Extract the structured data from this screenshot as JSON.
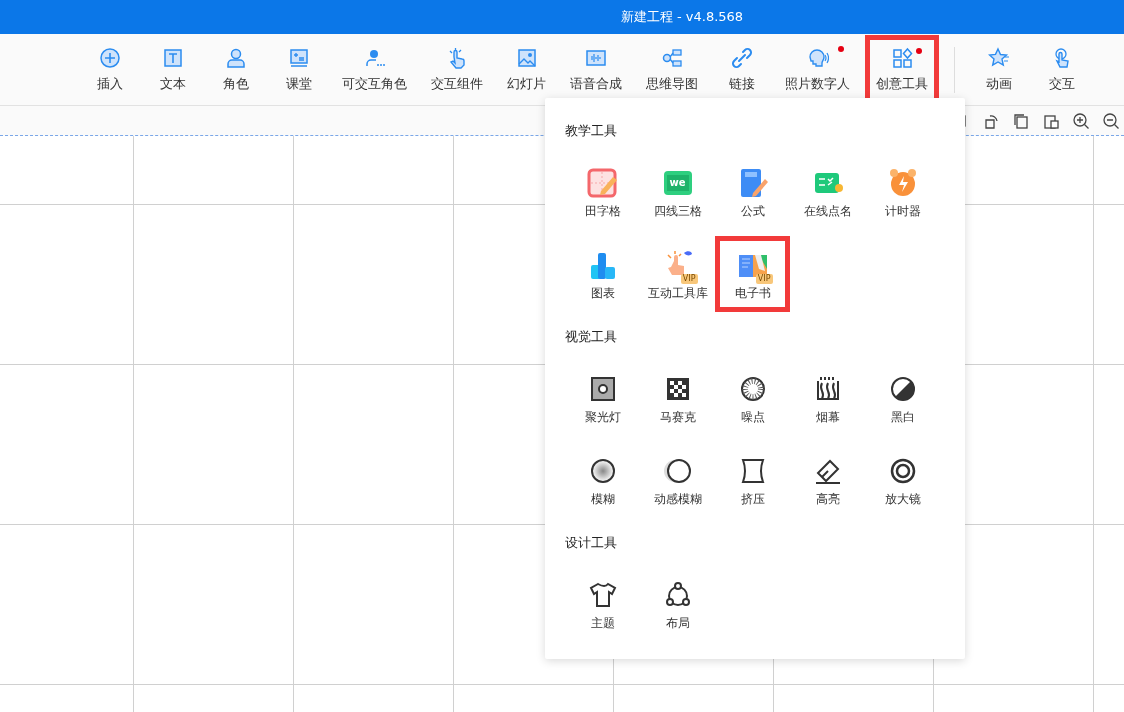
{
  "window": {
    "title": "新建工程 - v4.8.568"
  },
  "toolbar": [
    {
      "label": "插入",
      "dot": false,
      "highlighted": false
    },
    {
      "label": "文本",
      "dot": false,
      "highlighted": false
    },
    {
      "label": "角色",
      "dot": false,
      "highlighted": false
    },
    {
      "label": "课堂",
      "dot": false,
      "highlighted": false
    },
    {
      "label": "可交互角色",
      "dot": false,
      "highlighted": false
    },
    {
      "label": "交互组件",
      "dot": false,
      "highlighted": false
    },
    {
      "label": "幻灯片",
      "dot": false,
      "highlighted": false
    },
    {
      "label": "语音合成",
      "dot": false,
      "highlighted": false
    },
    {
      "label": "思维导图",
      "dot": false,
      "highlighted": false
    },
    {
      "label": "链接",
      "dot": false,
      "highlighted": false
    },
    {
      "label": "照片数字人",
      "dot": true,
      "highlighted": false
    },
    {
      "label": "创意工具",
      "dot": true,
      "highlighted": true
    }
  ],
  "toolbar_right": [
    {
      "label": "动画"
    },
    {
      "label": "交互"
    }
  ],
  "menu": {
    "sections": [
      {
        "title": "教学工具",
        "items": [
          {
            "label": "田字格",
            "highlighted": false
          },
          {
            "label": "四线三格",
            "icon_text": "we",
            "highlighted": false
          },
          {
            "label": "公式",
            "highlighted": false
          },
          {
            "label": "在线点名",
            "highlighted": false
          },
          {
            "label": "计时器",
            "highlighted": false
          },
          {
            "label": "图表",
            "highlighted": false
          },
          {
            "label": "互动工具库",
            "badge": "VIP",
            "highlighted": false
          },
          {
            "label": "电子书",
            "badge": "VIP",
            "highlighted": true
          }
        ]
      },
      {
        "title": "视觉工具",
        "items": [
          {
            "label": "聚光灯",
            "highlighted": false
          },
          {
            "label": "马赛克",
            "highlighted": false
          },
          {
            "label": "噪点",
            "highlighted": false
          },
          {
            "label": "烟幕",
            "highlighted": false
          },
          {
            "label": "黑白",
            "highlighted": false
          },
          {
            "label": "模糊",
            "highlighted": false
          },
          {
            "label": "动感模糊",
            "highlighted": false
          },
          {
            "label": "挤压",
            "highlighted": false
          },
          {
            "label": "高亮",
            "highlighted": false
          },
          {
            "label": "放大镜",
            "highlighted": false
          }
        ]
      },
      {
        "title": "设计工具",
        "items": [
          {
            "label": "主题",
            "highlighted": false
          },
          {
            "label": "布局",
            "highlighted": false
          }
        ]
      }
    ]
  }
}
